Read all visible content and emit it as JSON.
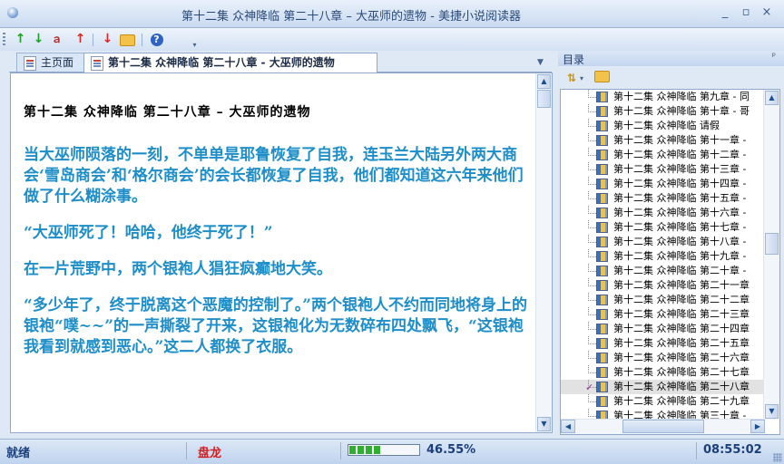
{
  "window": {
    "title": "第十二集 众神降临 第二十八章 – 大巫师的遗物 - 美捷小说阅读器",
    "controls": [
      "_",
      "▫",
      "×"
    ]
  },
  "toolbar": {
    "buttons": [
      {
        "name": "next-green-up-icon",
        "glyph": "↑",
        "color": "#1f9e2a"
      },
      {
        "name": "prev-green-down-icon",
        "glyph": "↓",
        "color": "#1f9e2a"
      },
      {
        "name": "font-icon",
        "glyph": "ａ",
        "color": "#b03030"
      },
      {
        "name": "scroll-up-icon",
        "glyph": "↑",
        "color": "#d12b2b"
      },
      {
        "name": "scroll-down-icon",
        "glyph": "↓",
        "color": "#d12b2b"
      },
      {
        "name": "open-folder-icon",
        "glyph": "",
        "color": "#f3c24a"
      },
      {
        "name": "help-icon",
        "glyph": "?",
        "color": "#2d63c4"
      }
    ]
  },
  "tabs": [
    {
      "label": "主页面",
      "active": false
    },
    {
      "label": "第十二集 众神降临 第二十八章 - 大巫师的遗物",
      "active": true
    }
  ],
  "reader": {
    "chapter_title": "第十二集 众神降临 第二十八章 – 大巫师的遗物",
    "paragraphs": [
      "当大巫师陨落的一刻，不单单是耶鲁恢复了自我，连玉兰大陆另外两大商会‘雪岛商会’和‘格尔商会’的会长都恢复了自我，他们都知道这六年来他们做了什么糊涂事。",
      "“大巫师死了！哈哈，他终于死了！”",
      "在一片荒野中，两个银袍人猖狂疯癫地大笑。",
      "“多少年了，终于脱离这个恶魔的控制了。”两个银袍人不约而同地将身上的银袍“噗~~”的一声撕裂了开来，这银袍化为无数碎布四处飘飞，“这银袍我看到就感到恶心。”这二人都换了衣服。"
    ]
  },
  "toc": {
    "title": "目录",
    "pin": "ᵖ",
    "items": [
      "第十二集 众神降临 第九章 - 同",
      "第十二集 众神降临 第十章 - 哥",
      "第十二集 众神降临 请假",
      "第十二集 众神降临 第十一章 -",
      "第十二集 众神降临 第十二章 -",
      "第十二集 众神降临 第十三章 -",
      "第十二集 众神降临 第十四章 -",
      "第十二集 众神降临 第十五章 -",
      "第十二集 众神降临 第十六章 -",
      "第十二集 众神降临 第十七章 -",
      "第十二集 众神降临 第十八章 -",
      "第十二集 众神降临 第十九章 -",
      "第十二集 众神降临 第二十章 -",
      "第十二集 众神降临 第二十一章",
      "第十二集 众神降临 第二十二章",
      "第十二集 众神降临 第二十三章",
      "第十二集 众神降临 第二十四章",
      "第十二集 众神降临 第二十五章",
      "第十二集 众神降临 第二十六章",
      "第十二集 众神降临 第二十七章",
      "第十二集 众神降临 第二十八章",
      "第十二集 众神降临 第二十九章",
      "第十二集 众神降临 第三十章 -"
    ],
    "selected_index": 20
  },
  "status": {
    "state": "就绪",
    "author": "盘龙",
    "progress_percent": 46.55,
    "progress_text": "46.55%",
    "clock": "08:55:02"
  },
  "colors": {
    "text": "#1e8ec9",
    "author": "#d11f1f",
    "status": "#1b3f7a"
  }
}
